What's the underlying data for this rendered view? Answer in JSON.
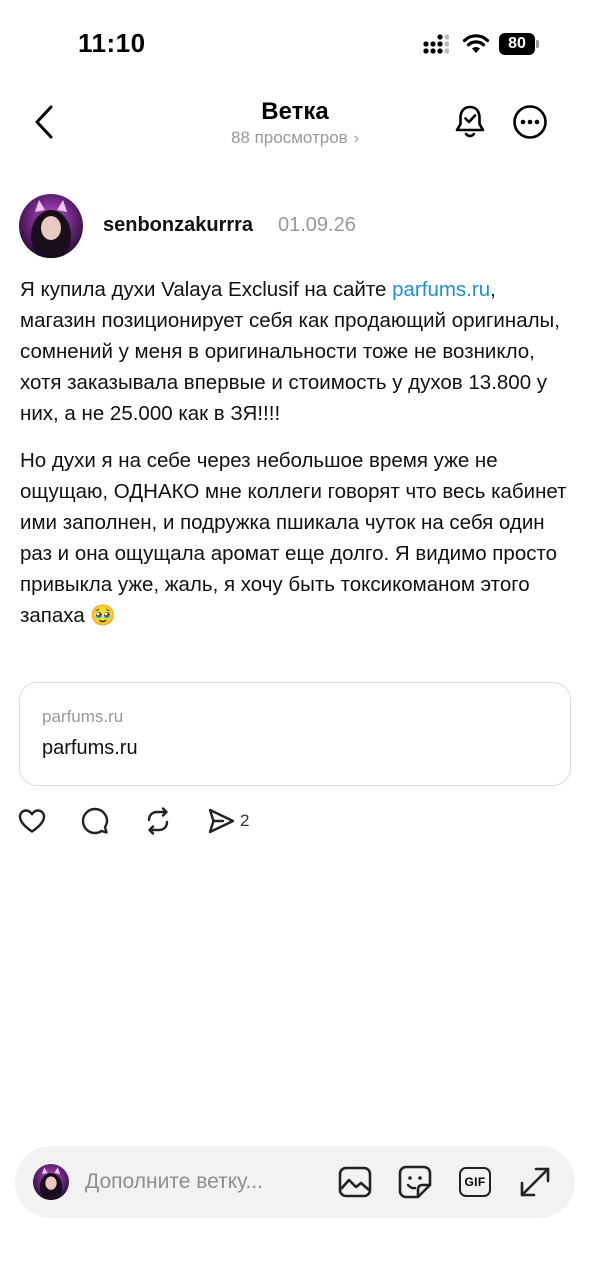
{
  "status_bar": {
    "time": "11:10",
    "battery": "80"
  },
  "header": {
    "title": "Ветка",
    "views": "88 просмотров",
    "views_chevron": "›"
  },
  "post": {
    "username": "senbonzakurrra",
    "date": "01.09.26",
    "paragraph1_before_link": "Я купила духи Valaya Exclusif на сайте ",
    "paragraph1_link": "parfums.ru",
    "paragraph1_after_link": ", магазин позиционирует себя как продающий оригиналы, сомнений у меня в оригинальности тоже не возникло, хотя заказывала впервые и стоимость у духов 13.800 у них, а не 25.000 как в ЗЯ!!!!",
    "paragraph2": "Но духи я на себе через небольшое время уже не ощущаю, ОДНАКО мне коллеги говорят что весь кабинет ими заполнен, и подружка пшикала чуток на себя один раз и она ощущала аромат еще долго. Я видимо просто привыкла уже, жаль, я хочу быть токсикоманом этого запаха 🥹",
    "link_card": {
      "domain": "parfums.ru",
      "title": "parfums.ru"
    },
    "actions": {
      "like_icon": "heart-icon",
      "reply_icon": "comment-icon",
      "repost_icon": "repost-icon",
      "share_icon": "send-icon",
      "share_count": "2"
    }
  },
  "composer": {
    "placeholder": "Дополните ветку...",
    "buttons": [
      "image-icon",
      "sticker-icon",
      "gif-icon",
      "expand-icon"
    ],
    "gif_label": "GIF"
  }
}
